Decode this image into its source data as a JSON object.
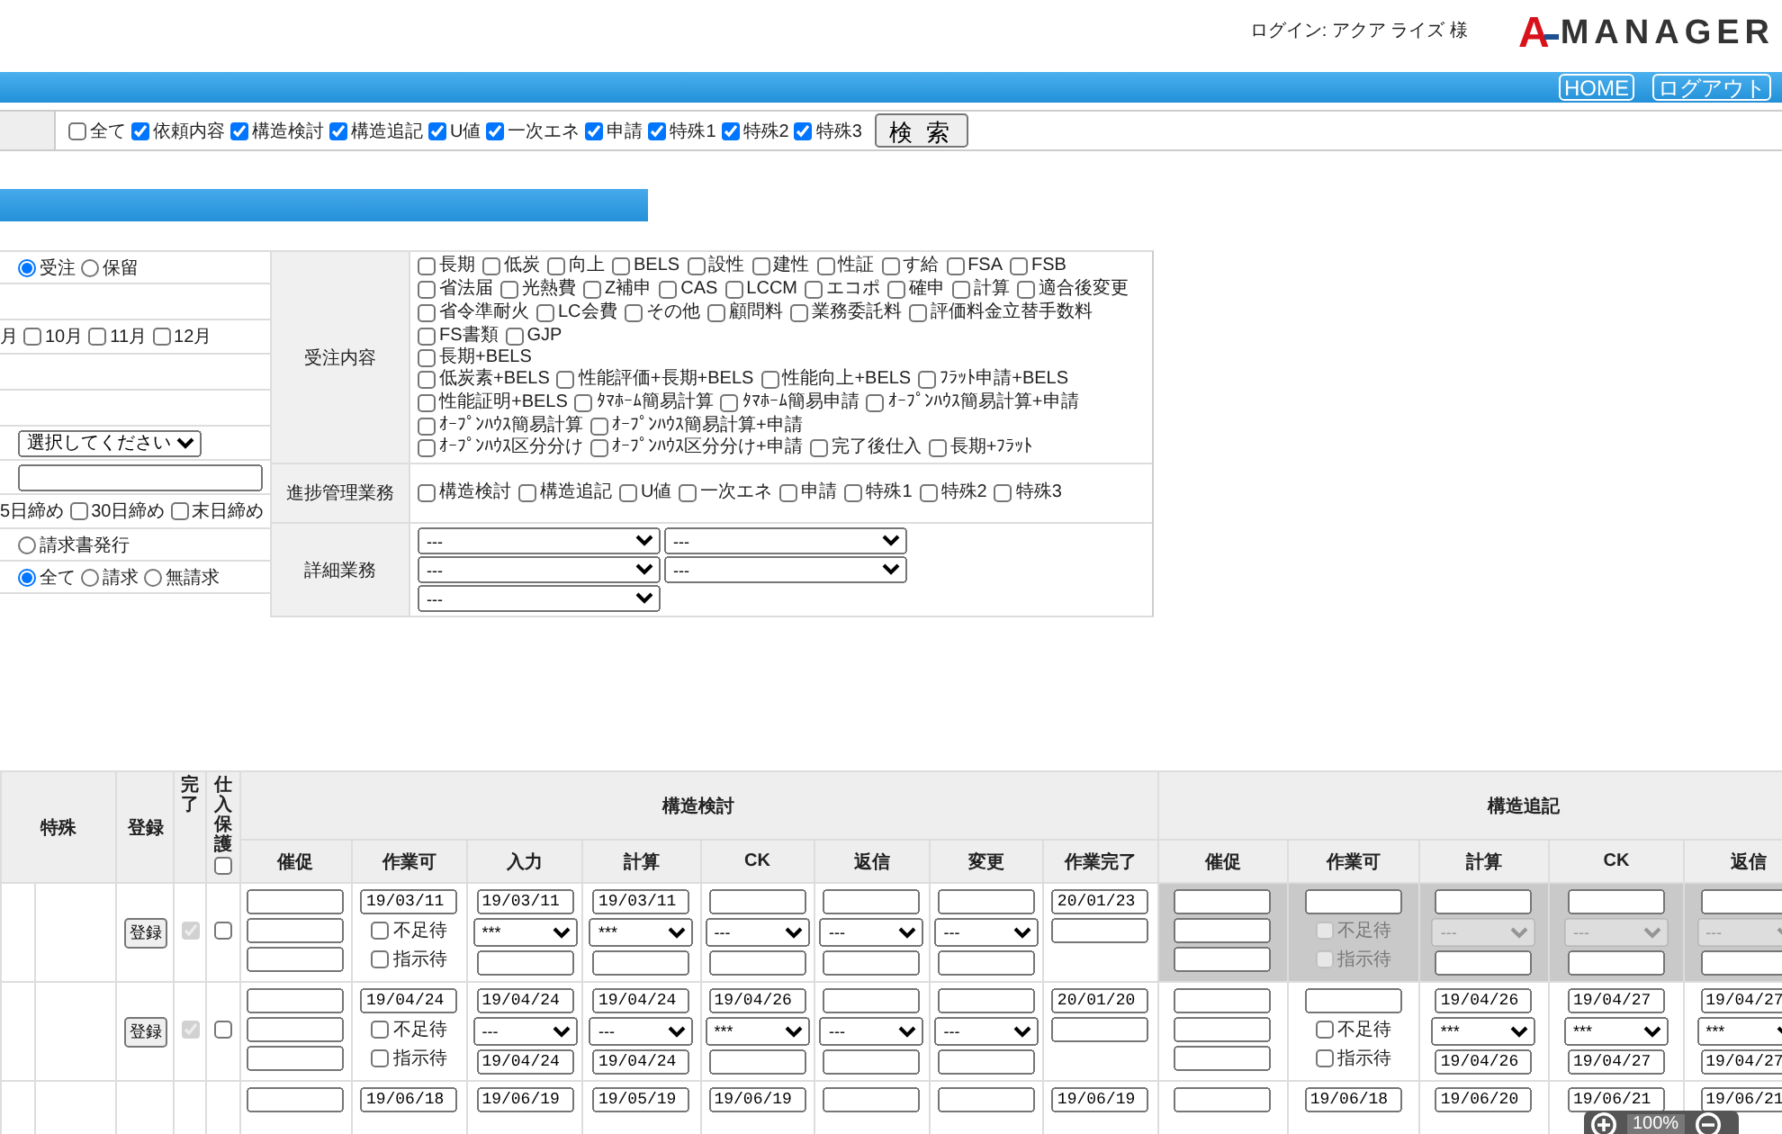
{
  "header": {
    "login": "ログイン: アクア ライズ 様",
    "logo": {
      "mark": "A",
      "text": "MANAGER"
    }
  },
  "nav_buttons": [
    "HOME",
    "ログアウト"
  ],
  "filter": {
    "options": [
      {
        "label": "全て",
        "checked": false
      },
      {
        "label": "依頼内容",
        "checked": true
      },
      {
        "label": "構造検討",
        "checked": true
      },
      {
        "label": "構造追記",
        "checked": true
      },
      {
        "label": "U値",
        "checked": true
      },
      {
        "label": "一次エネ",
        "checked": true
      },
      {
        "label": "申請",
        "checked": true
      },
      {
        "label": "特殊1",
        "checked": true
      },
      {
        "label": "特殊2",
        "checked": true
      },
      {
        "label": "特殊3",
        "checked": true
      }
    ],
    "search_button": "検 索"
  },
  "left_form": {
    "rows": [
      {
        "kind": "radios",
        "options": [
          {
            "label": "受注",
            "selected": true
          },
          {
            "label": "保留",
            "selected": false
          }
        ]
      },
      {
        "kind": "blank"
      },
      {
        "kind": "checks",
        "lead": "月",
        "options": [
          {
            "label": "10月",
            "checked": false
          },
          {
            "label": "11月",
            "checked": false
          },
          {
            "label": "12月",
            "checked": false
          }
        ]
      },
      {
        "kind": "blank"
      },
      {
        "kind": "blank"
      },
      {
        "kind": "select",
        "value": "選択してください"
      },
      {
        "kind": "input"
      },
      {
        "kind": "checks",
        "lead": "5日締め",
        "options": [
          {
            "label": "30日締め",
            "checked": false
          },
          {
            "label": "末日締め",
            "checked": false
          }
        ]
      },
      {
        "kind": "radios",
        "options": [
          {
            "label": "請求書発行",
            "selected": false
          }
        ]
      },
      {
        "kind": "radios",
        "options": [
          {
            "label": "全て",
            "selected": true
          },
          {
            "label": "請求",
            "selected": false
          },
          {
            "label": "無請求",
            "selected": false
          }
        ]
      }
    ]
  },
  "right_form": {
    "order_label": "受注内容",
    "order_groups": [
      [
        {
          "label": "長期",
          "checked": false
        },
        {
          "label": "低炭",
          "checked": false
        },
        {
          "label": "向上",
          "checked": false
        },
        {
          "label": "BELS",
          "checked": false
        },
        {
          "label": "設性",
          "checked": false
        },
        {
          "label": "建性",
          "checked": false
        },
        {
          "label": "性証",
          "checked": false
        },
        {
          "label": "す給",
          "checked": false
        },
        {
          "label": "FSA",
          "checked": false
        },
        {
          "label": "FSB",
          "checked": false
        },
        {
          "label": "省法届",
          "checked": false
        },
        {
          "label": "光熱費",
          "checked": false
        },
        {
          "label": "Z補申",
          "checked": false
        },
        {
          "label": "CAS",
          "checked": false
        },
        {
          "label": "LCCM",
          "checked": false
        },
        {
          "label": "エコポ",
          "checked": false
        },
        {
          "label": "確申",
          "checked": false
        },
        {
          "label": "計算",
          "checked": false
        },
        {
          "label": "適合後変更",
          "checked": false
        },
        {
          "label": "省令準耐火",
          "checked": false
        },
        {
          "label": "LC会費",
          "checked": false
        },
        {
          "label": "その他",
          "checked": false
        },
        {
          "label": "顧問料",
          "checked": false
        },
        {
          "label": "業務委託料",
          "checked": false
        },
        {
          "label": "評価料金立替手数料",
          "checked": false
        },
        {
          "label": "FS書類",
          "checked": false
        },
        {
          "label": "GJP",
          "checked": false
        }
      ],
      [
        {
          "label": "長期+BELS",
          "checked": false
        }
      ],
      [
        {
          "label": "低炭素+BELS",
          "checked": false
        },
        {
          "label": "性能評価+長期+BELS",
          "checked": false
        },
        {
          "label": "性能向上+BELS",
          "checked": false
        },
        {
          "label": "ﾌﾗｯﾄ申請+BELS",
          "checked": false
        },
        {
          "label": "性能証明+BELS",
          "checked": false
        },
        {
          "label": "ﾀﾏﾎｰﾑ簡易計算",
          "checked": false
        },
        {
          "label": "ﾀﾏﾎｰﾑ簡易申請",
          "checked": false
        },
        {
          "label": "ｵｰﾌﾟﾝﾊｳｽ簡易計算+申請",
          "checked": false
        },
        {
          "label": "ｵｰﾌﾟﾝﾊｳｽ簡易計算",
          "checked": false
        },
        {
          "label": "ｵｰﾌﾟﾝﾊｳｽ簡易計算+申請",
          "checked": false
        }
      ],
      [
        {
          "label": "ｵｰﾌﾟﾝﾊｳｽ区分分け",
          "checked": false
        },
        {
          "label": "ｵｰﾌﾟﾝﾊｳｽ区分分け+申請",
          "checked": false
        },
        {
          "label": "完了後仕入",
          "checked": false
        },
        {
          "label": "長期+ﾌﾗｯﾄ",
          "checked": false
        }
      ]
    ],
    "progress_label": "進捗管理業務",
    "progress_options": [
      {
        "label": "構造検討",
        "checked": false
      },
      {
        "label": "構造追記",
        "checked": false
      },
      {
        "label": "U値",
        "checked": false
      },
      {
        "label": "一次エネ",
        "checked": false
      },
      {
        "label": "申請",
        "checked": false
      },
      {
        "label": "特殊1",
        "checked": false
      },
      {
        "label": "特殊2",
        "checked": false
      },
      {
        "label": "特殊3",
        "checked": false
      }
    ],
    "detail_label": "詳細業務",
    "detail_selects": [
      "---",
      "---",
      "---",
      "---",
      "---"
    ]
  },
  "grid": {
    "lead_headers": {
      "special": "特殊",
      "register": "登録",
      "done": "完了",
      "protect": "仕入保護",
      "protect_all": false
    },
    "groups": [
      {
        "title": "構造検討",
        "columns": [
          "催促",
          "作業可",
          "入力",
          "計算",
          "CK",
          "返信",
          "変更",
          "作業完了"
        ]
      },
      {
        "title": "構造追記",
        "columns": [
          "催促",
          "作業可",
          "計算",
          "CK",
          "返信"
        ]
      }
    ],
    "rows": [
      {
        "register": "登録",
        "done": true,
        "protect": false,
        "groups": [
          {
            "disabled": false,
            "cells": [
              {
                "kind": "reminder"
              },
              {
                "kind": "work",
                "date": "19/03/11",
                "checks": [
                  {
                    "label": "不足待",
                    "checked": false
                  },
                  {
                    "label": "指示待",
                    "checked": false
                  }
                ]
              },
              {
                "kind": "stage",
                "top": "19/03/11",
                "select": "***"
              },
              {
                "kind": "stage",
                "top": "19/03/11",
                "select": "***"
              },
              {
                "kind": "stage",
                "select": "---"
              },
              {
                "kind": "stage",
                "select": "---"
              },
              {
                "kind": "stage",
                "select": "---"
              },
              {
                "kind": "finish",
                "date": "20/01/23"
              }
            ]
          },
          {
            "disabled": true,
            "cells": [
              {
                "kind": "reminder"
              },
              {
                "kind": "work",
                "checks": [
                  {
                    "label": "不足待",
                    "checked": false
                  },
                  {
                    "label": "指示待",
                    "checked": false
                  }
                ]
              },
              {
                "kind": "stage",
                "select": "---"
              },
              {
                "kind": "stage",
                "select": "---"
              },
              {
                "kind": "stage",
                "select": "---"
              }
            ]
          }
        ]
      },
      {
        "register": "登録",
        "done": true,
        "protect": false,
        "groups": [
          {
            "disabled": false,
            "cells": [
              {
                "kind": "reminder"
              },
              {
                "kind": "work",
                "date": "19/04/24",
                "checks": [
                  {
                    "label": "不足待",
                    "checked": false
                  },
                  {
                    "label": "指示待",
                    "checked": false
                  }
                ]
              },
              {
                "kind": "stage",
                "top": "19/04/24",
                "select": "---",
                "bottom": "19/04/24"
              },
              {
                "kind": "stage",
                "top": "19/04/24",
                "select": "---",
                "bottom": "19/04/24"
              },
              {
                "kind": "stage",
                "top": "19/04/26",
                "select": "***"
              },
              {
                "kind": "stage",
                "select": "---"
              },
              {
                "kind": "stage",
                "select": "---"
              },
              {
                "kind": "finish",
                "date": "20/01/20"
              }
            ]
          },
          {
            "disabled": false,
            "cells": [
              {
                "kind": "reminder"
              },
              {
                "kind": "work",
                "checks": [
                  {
                    "label": "不足待",
                    "checked": false
                  },
                  {
                    "label": "指示待",
                    "checked": false
                  }
                ]
              },
              {
                "kind": "stage",
                "top": "19/04/26",
                "select": "***",
                "bottom": "19/04/26"
              },
              {
                "kind": "stage",
                "top": "19/04/27",
                "select": "***",
                "bottom": "19/04/27"
              },
              {
                "kind": "stage",
                "top": "19/04/27",
                "select": "***",
                "bottom": "19/04/27"
              }
            ]
          }
        ]
      },
      {
        "groups": [
          {
            "disabled": false,
            "cells": [
              {
                "kind": "single"
              },
              {
                "kind": "single",
                "value": "19/06/18"
              },
              {
                "kind": "single",
                "value": "19/06/19"
              },
              {
                "kind": "single",
                "value": "19/05/19"
              },
              {
                "kind": "single",
                "value": "19/06/19"
              },
              {
                "kind": "single"
              },
              {
                "kind": "single"
              },
              {
                "kind": "single",
                "value": "19/06/19"
              }
            ]
          },
          {
            "disabled": false,
            "cells": [
              {
                "kind": "single"
              },
              {
                "kind": "single",
                "value": "19/06/18"
              },
              {
                "kind": "single",
                "value": "19/06/20"
              },
              {
                "kind": "single",
                "value": "19/06/21"
              },
              {
                "kind": "single",
                "value": "19/06/21"
              }
            ]
          }
        ]
      }
    ]
  },
  "zoom_control": {
    "value": "100%"
  }
}
